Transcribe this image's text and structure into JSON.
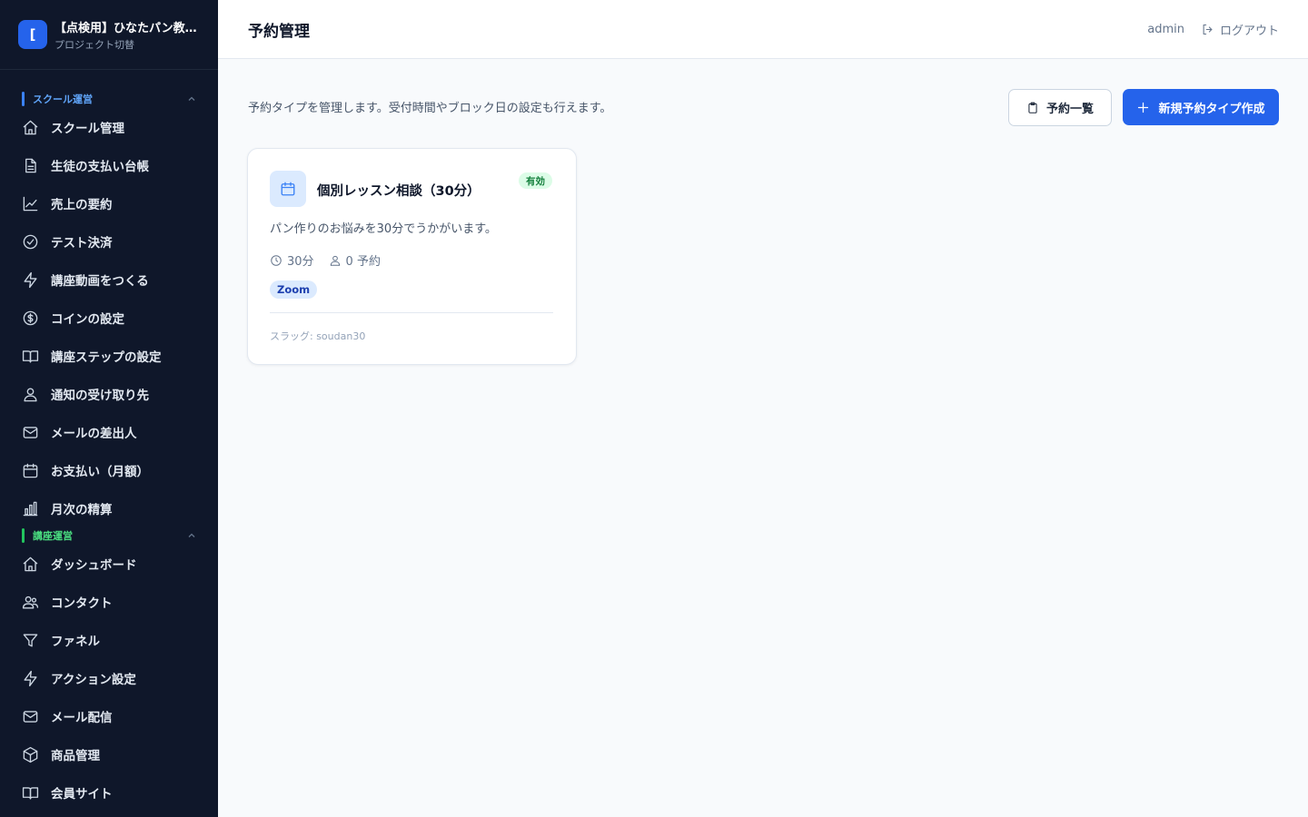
{
  "project": {
    "logo_letter": "[",
    "name": "【点検用】ひなたパン教室のアカデミー",
    "switch_label": "プロジェクト切替"
  },
  "sidebar": {
    "section1": {
      "label": "スクール運営",
      "items": [
        {
          "label": "スクール管理",
          "icon": "home-icon"
        },
        {
          "label": "生徒の支払い台帳",
          "icon": "document-icon"
        },
        {
          "label": "売上の要約",
          "icon": "chart-line-icon"
        },
        {
          "label": "テスト決済",
          "icon": "check-circle-icon"
        },
        {
          "label": "講座動画をつくる",
          "icon": "bolt-icon"
        },
        {
          "label": "コインの設定",
          "icon": "coin-icon"
        },
        {
          "label": "講座ステップの設定",
          "icon": "book-icon"
        },
        {
          "label": "通知の受け取り先",
          "icon": "users-icon"
        },
        {
          "label": "メールの差出人",
          "icon": "mail-icon"
        },
        {
          "label": "お支払い（月額）",
          "icon": "calendar-icon"
        },
        {
          "label": "月次の精算",
          "icon": "bar-chart-icon"
        }
      ]
    },
    "section2": {
      "label": "講座運営",
      "items": [
        {
          "label": "ダッシュボード",
          "icon": "home-icon"
        },
        {
          "label": "コンタクト",
          "icon": "group-icon"
        },
        {
          "label": "ファネル",
          "icon": "funnel-icon"
        },
        {
          "label": "アクション設定",
          "icon": "bolt-icon"
        },
        {
          "label": "メール配信",
          "icon": "mail-icon"
        },
        {
          "label": "商品管理",
          "icon": "box-icon"
        },
        {
          "label": "会員サイト",
          "icon": "book-icon"
        }
      ]
    }
  },
  "header": {
    "title": "予約管理",
    "user": "admin",
    "logout_label": "ログアウト"
  },
  "main": {
    "description": "予約タイプを管理します。受付時間やブロック日の設定も行えます。",
    "list_button": "予約一覧",
    "new_button": "新規予約タイプ作成"
  },
  "cards": [
    {
      "title": "個別レッスン相談（30分）",
      "status": "有効",
      "description": "パン作りのお悩みを30分でうかがいます。",
      "duration": "30分",
      "bookings": "0 予約",
      "tag": "Zoom",
      "slug": "スラッグ: soudan30"
    }
  ],
  "colors": {
    "sidebar_bg": "#0f172a",
    "accent": "#2563eb",
    "section1_accent": "#3b82f6",
    "section2_accent": "#22c55e",
    "active_badge_bg": "#dcfce7",
    "active_badge_text": "#15803d"
  }
}
